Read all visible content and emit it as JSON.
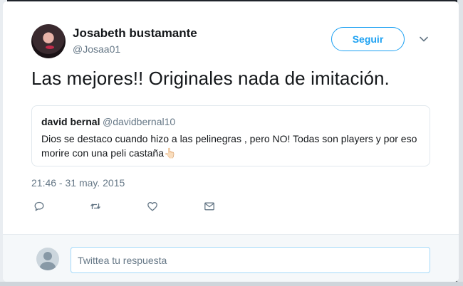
{
  "author": {
    "name": "Josabeth bustamante",
    "handle": "@Josaa01"
  },
  "follow_button": {
    "label": "Seguir"
  },
  "tweet": {
    "text": "Las mejores!! Originales nada de imitación.",
    "timestamp": "21:46 - 31 may. 2015"
  },
  "quoted_tweet": {
    "name": "david bernal",
    "handle": "@davidbernal10",
    "text": "Dios se destaco cuando hizo a las pelinegras , pero NO! Todas son players y por eso morire con una peli castaña👆🏻"
  },
  "actions": [
    {
      "icon": "reply-icon"
    },
    {
      "icon": "retweet-icon"
    },
    {
      "icon": "like-icon"
    },
    {
      "icon": "message-icon"
    }
  ],
  "reply": {
    "placeholder": "Twittea tu respuesta"
  },
  "colors": {
    "accent": "#1da1f2",
    "secondary_text": "#657786"
  }
}
